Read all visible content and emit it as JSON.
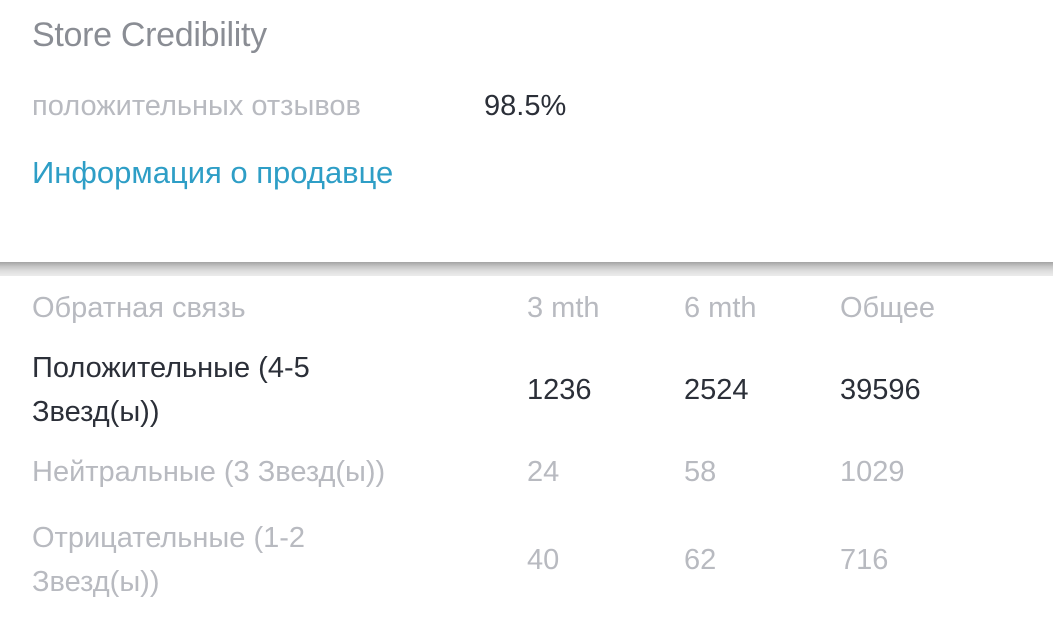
{
  "store": {
    "title": "Store Credibility",
    "positive_feedback_label": "положительных отзывов",
    "positive_feedback_value": "98.5%",
    "seller_info_link": "Информация о продавце"
  },
  "feedback_table": {
    "headers": [
      "Обратная связь",
      "3 mth",
      "6 mth",
      "Общее"
    ],
    "rows": [
      {
        "label": "Положительные (4-5 Звезд(ы))",
        "m3": "1236",
        "m6": "2524",
        "total": "39596"
      },
      {
        "label": "Нейтральные (3 Звезд(ы))",
        "m3": "24",
        "m6": "58",
        "total": "1029"
      },
      {
        "label": "Отрицательные (1-2 Звезд(ы))",
        "m3": "40",
        "m6": "62",
        "total": "716"
      }
    ]
  },
  "colors": {
    "title_gray": "#8a8d94",
    "muted_gray": "#b8bac0",
    "dark_text": "#2b2f38",
    "link_blue": "#2e9ec6"
  }
}
